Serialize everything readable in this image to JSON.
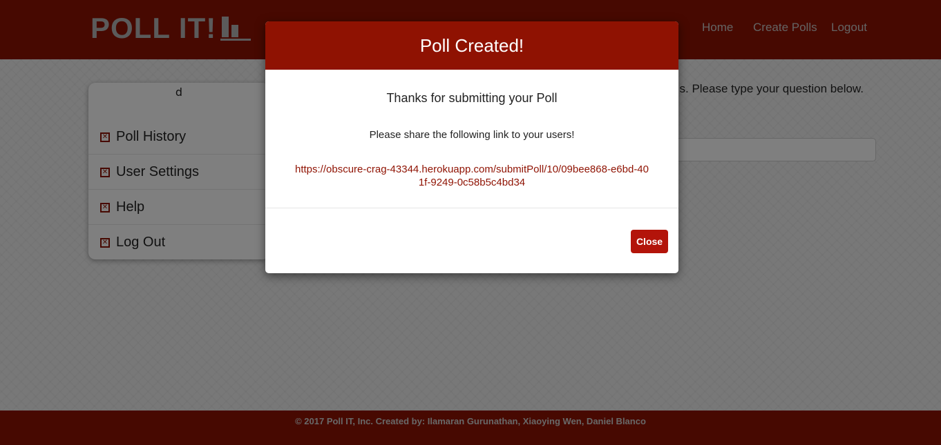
{
  "brand": {
    "name": "POLL IT!",
    "logo_icon": "bar-chart-icon"
  },
  "nav": {
    "links": [
      "Home",
      "Create Polls",
      "Logout"
    ]
  },
  "sidebar": {
    "username": "d",
    "items": [
      {
        "icon": "close-x-icon",
        "label": "Poll History"
      },
      {
        "icon": "close-x-icon",
        "label": "User Settings"
      },
      {
        "icon": "close-x-icon",
        "label": "Help"
      },
      {
        "icon": "close-x-icon",
        "label": "Log Out"
      }
    ]
  },
  "main": {
    "instruction_visible": "s. Please type your question below.",
    "question_value": ""
  },
  "modal": {
    "title": "Poll Created!",
    "subtitle": "Thanks for submitting your Poll",
    "share_text": "Please share the following link to your users!",
    "link": "https://obscure-crag-43344.herokuapp.com/submitPoll/10/09bee868-e6bd-401f-9249-0c58b5c4bd34",
    "close_label": "Close"
  },
  "footer": {
    "text": "© 2017 Poll IT, Inc. Created by: Ilamaran Gurunathan, Xiaoying Wen, Daniel Blanco"
  },
  "colors": {
    "brand_red": "#8f1202",
    "button_red": "#b3140a",
    "backdrop": "rgba(0,0,0,0.5)"
  }
}
